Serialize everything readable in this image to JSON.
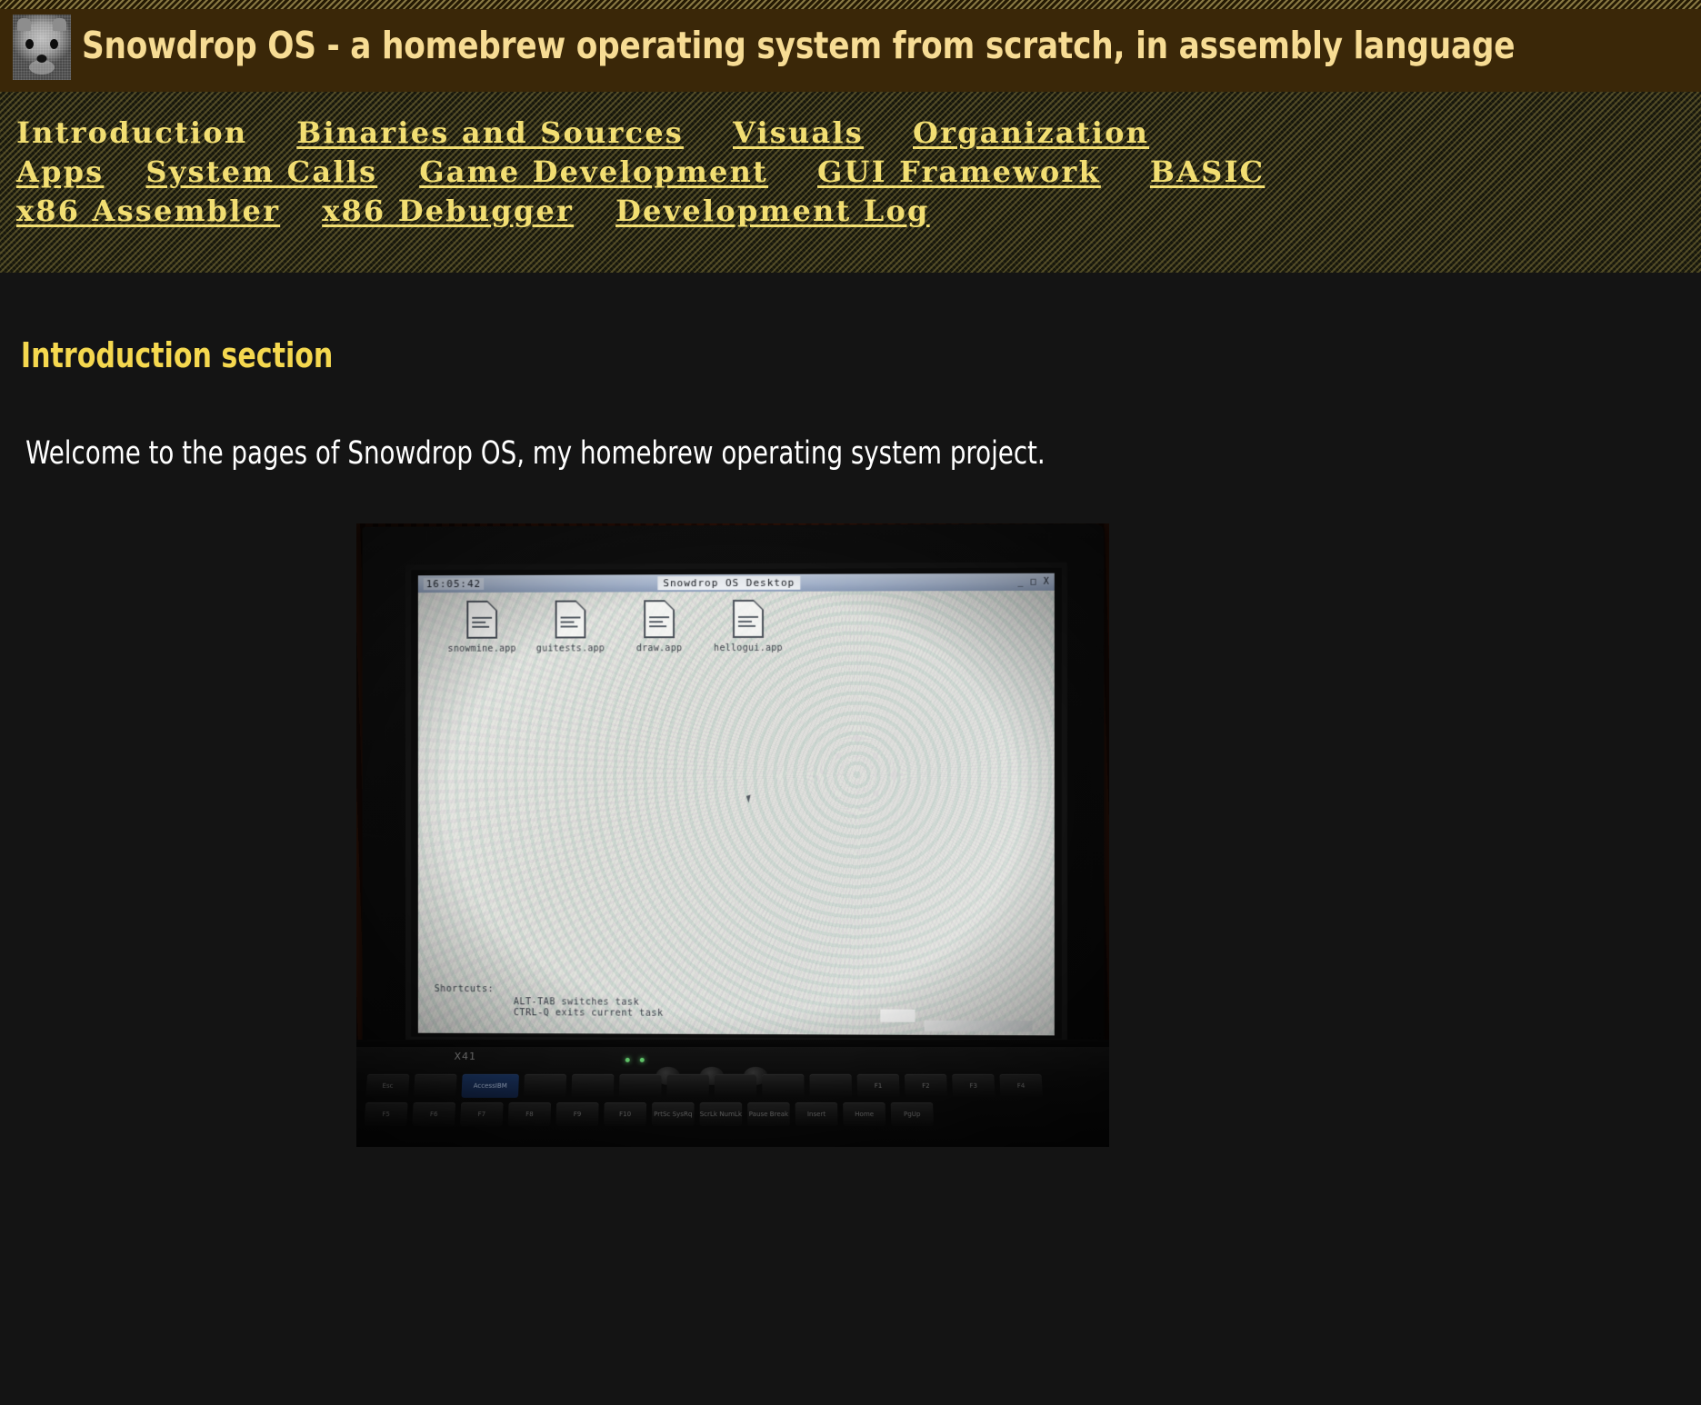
{
  "header": {
    "title": "Snowdrop OS - a homebrew operating system from scratch, in assembly language",
    "logo_icon": "dog-face-icon",
    "background_color": "#3a2708",
    "title_color": "#f7dc94"
  },
  "nav": {
    "rows": [
      [
        {
          "label": "Introduction",
          "current": true
        },
        {
          "label": "Binaries and Sources",
          "current": false
        },
        {
          "label": "Visuals",
          "current": false
        },
        {
          "label": "Organization",
          "current": false
        }
      ],
      [
        {
          "label": "Apps",
          "current": false
        },
        {
          "label": "System Calls",
          "current": false
        },
        {
          "label": "Game Development",
          "current": false
        },
        {
          "label": "GUI Framework",
          "current": false
        },
        {
          "label": "BASIC",
          "current": false
        }
      ],
      [
        {
          "label": "x86 Assembler",
          "current": false
        },
        {
          "label": "x86 Debugger",
          "current": false
        },
        {
          "label": "Development Log",
          "current": false
        }
      ]
    ],
    "link_color": "#f2de72"
  },
  "main": {
    "section_heading": "Introduction section",
    "welcome_text": "Welcome to the pages of Snowdrop OS, my homebrew operating system project.",
    "heading_color": "#f5d84f",
    "text_color": "#ffffff",
    "page_background": "#141414"
  },
  "photo": {
    "caption_alt": "laptop running Snowdrop OS desktop",
    "laptop_model": "X41",
    "os_desktop": {
      "clock": "16:05:42",
      "window_title": "Snowdrop OS Desktop",
      "window_buttons": "_ □ X",
      "icons": [
        {
          "label": "snowmine.app",
          "icon": "document-icon"
        },
        {
          "label": "guitests.app",
          "icon": "document-icon"
        },
        {
          "label": "draw.app",
          "icon": "document-icon"
        },
        {
          "label": "hellogui.app",
          "icon": "document-icon"
        }
      ],
      "shortcuts_label": "Shortcuts:",
      "shortcut_lines": [
        "ALT-TAB switches task",
        "CTRL-Q exits current task"
      ]
    },
    "keyboard": {
      "row1": [
        "Esc",
        "",
        "",
        "",
        "",
        ""
      ],
      "fn_key_label": "AccessIBM",
      "row2": [
        "F1",
        "F2",
        "F3",
        "F4",
        "F5",
        "F6",
        "F7",
        "F8",
        "F9",
        "F10",
        "",
        "PrtSc SysRq",
        "ScrLk NumLk",
        "Pause Break",
        "Insert",
        "Home",
        "PgUp"
      ]
    }
  }
}
